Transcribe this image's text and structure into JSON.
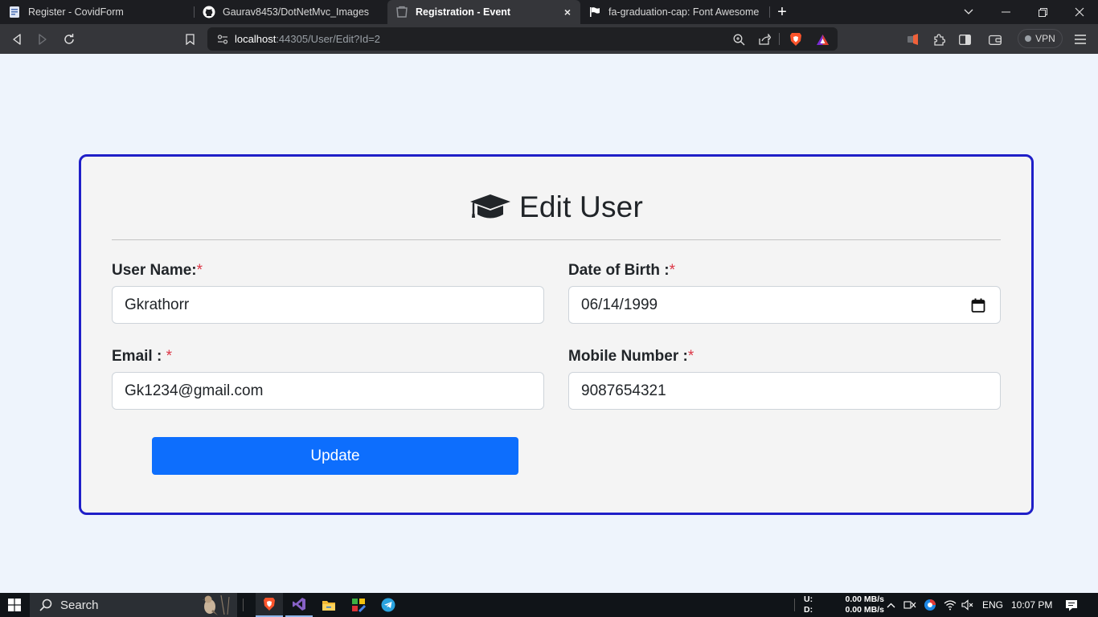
{
  "browser": {
    "tabs": [
      {
        "title": "Register - CovidForm",
        "icon": "document-icon",
        "active": false
      },
      {
        "title": "Gaurav8453/DotNetMvc_Images",
        "icon": "github-icon",
        "active": false
      },
      {
        "title": "Registration - Event",
        "icon": "page-icon",
        "active": true
      },
      {
        "title": "fa-graduation-cap: Font Awesome Icons",
        "icon": "flag-icon",
        "active": false
      }
    ],
    "tab_close_glyph": "×",
    "new_tab_glyph": "+",
    "url": {
      "host": "localhost",
      "rest": ":44305/User/Edit?Id=2"
    },
    "vpn_label": "VPN"
  },
  "form": {
    "title": "Edit User",
    "icon": "graduation-cap-icon",
    "required_mark": "*",
    "fields": {
      "username": {
        "label": "User Name:",
        "value": "Gkrathorr"
      },
      "dob": {
        "label": "Date of Birth :",
        "value": "06/14/1999"
      },
      "email": {
        "label": "Email : ",
        "value": "Gk1234@gmail.com"
      },
      "mobile": {
        "label": "Mobile Number :",
        "value": "9087654321"
      }
    },
    "submit_label": "Update"
  },
  "taskbar": {
    "search_label": "Search",
    "net_up_label": "U:",
    "net_down_label": "D:",
    "net_up_value": "0.00 MB/s",
    "net_down_value": "0.00 MB/s",
    "language": "ENG",
    "time": "10:07 PM"
  },
  "colors": {
    "card_border": "#1f1fc8",
    "button": "#0d6efd",
    "required": "#dc3545",
    "page_bg": "#eef4fc"
  }
}
